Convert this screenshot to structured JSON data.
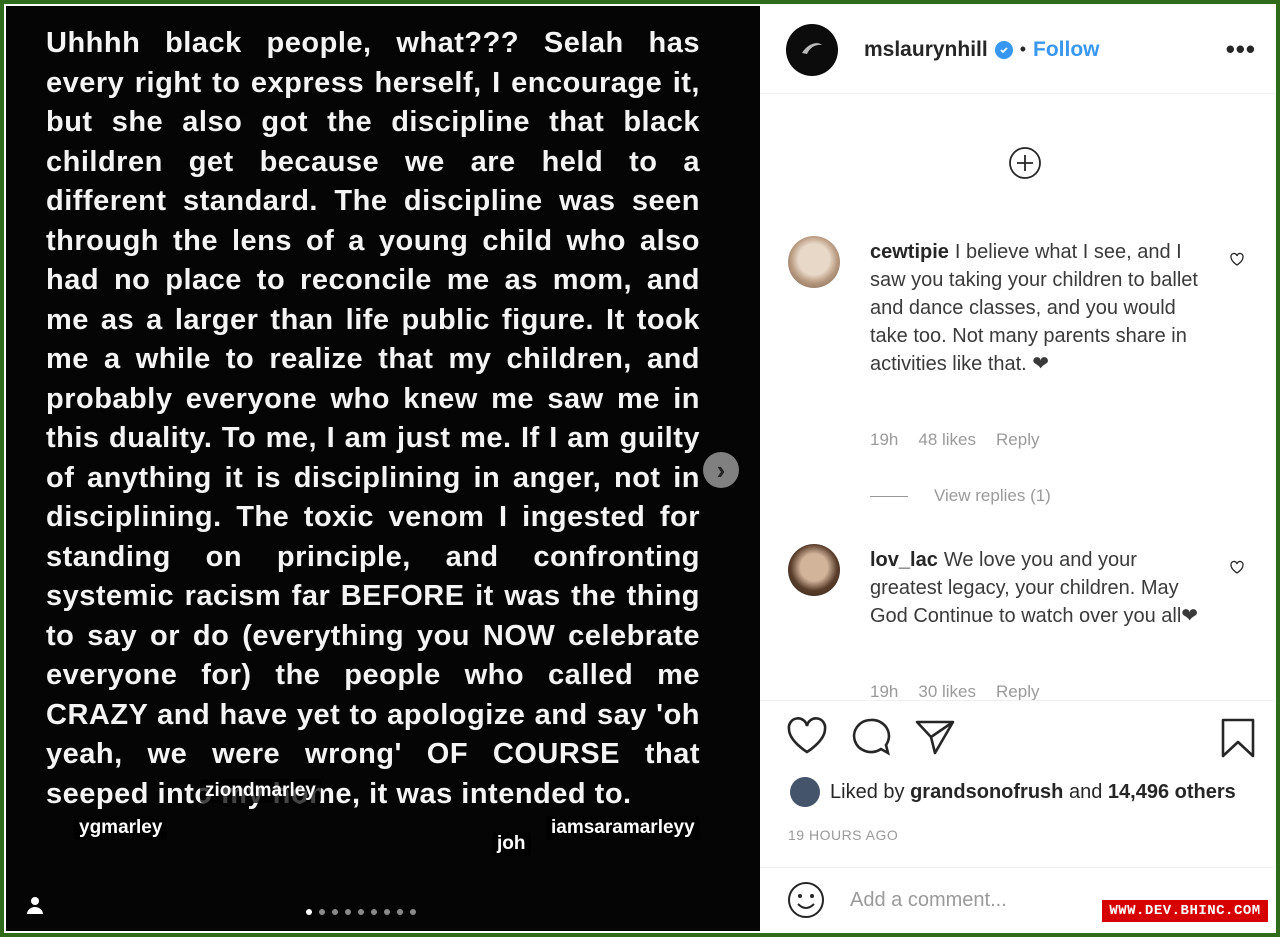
{
  "post": {
    "text": "Uhhhh black people, what??? Selah has every right to express herself, I encourage it, but she also got the discipline that black children get because we are held to a different standard. The discipline was seen through the lens of a young child who also had no place to reconcile me as mom, and me as a larger than life public figure. It took me a while to realize that my children, and probably everyone who knew me saw me in this duality. To me, I am just me. If I am guilty of anything it is disciplining in anger, not in disciplining. The toxic venom I ingested for standing on principle, and confronting systemic racism far BEFORE it was the thing to say or do (everything you NOW celebrate everyone for) the people who called me CRAZY and have yet to apologize and say 'oh yeah, we were wrong' OF COURSE that seeped into my home, it was intended to.",
    "tags": [
      "ziondmarley",
      "ygmarley",
      "joh",
      "iamsaramarleyy"
    ],
    "carousel": {
      "count": 9,
      "active": 1
    }
  },
  "header": {
    "username": "mslaurynhill",
    "separator": "•",
    "follow_label": "Follow",
    "more_label": "•••"
  },
  "comments": [
    {
      "user": "cewtipie",
      "text": "I believe what I see, and I saw you taking your children to ballet and dance classes, and you would take too. Not many parents share in activities like that. ❤",
      "time": "19h",
      "likes": "48 likes",
      "reply_label": "Reply",
      "view_replies": "View replies (1)"
    },
    {
      "user": "lov_lac",
      "text": "We love you and your greatest legacy, your children. May God Continue to watch over you all❤",
      "time": "19h",
      "likes": "30 likes",
      "reply_label": "Reply"
    }
  ],
  "likes": {
    "prefix": "Liked by",
    "user": "grandsonofrush",
    "and": "and",
    "count": "14,496 others"
  },
  "time_ago": "19 HOURS AGO",
  "add_comment": {
    "placeholder": "Add a comment..."
  },
  "watermark": "WWW.DEV.BHINC.COM",
  "colors": {
    "follow": "#3897f0",
    "heart": "#e0263c",
    "frame": "#2f6b1a",
    "watermark": "#d60000"
  }
}
